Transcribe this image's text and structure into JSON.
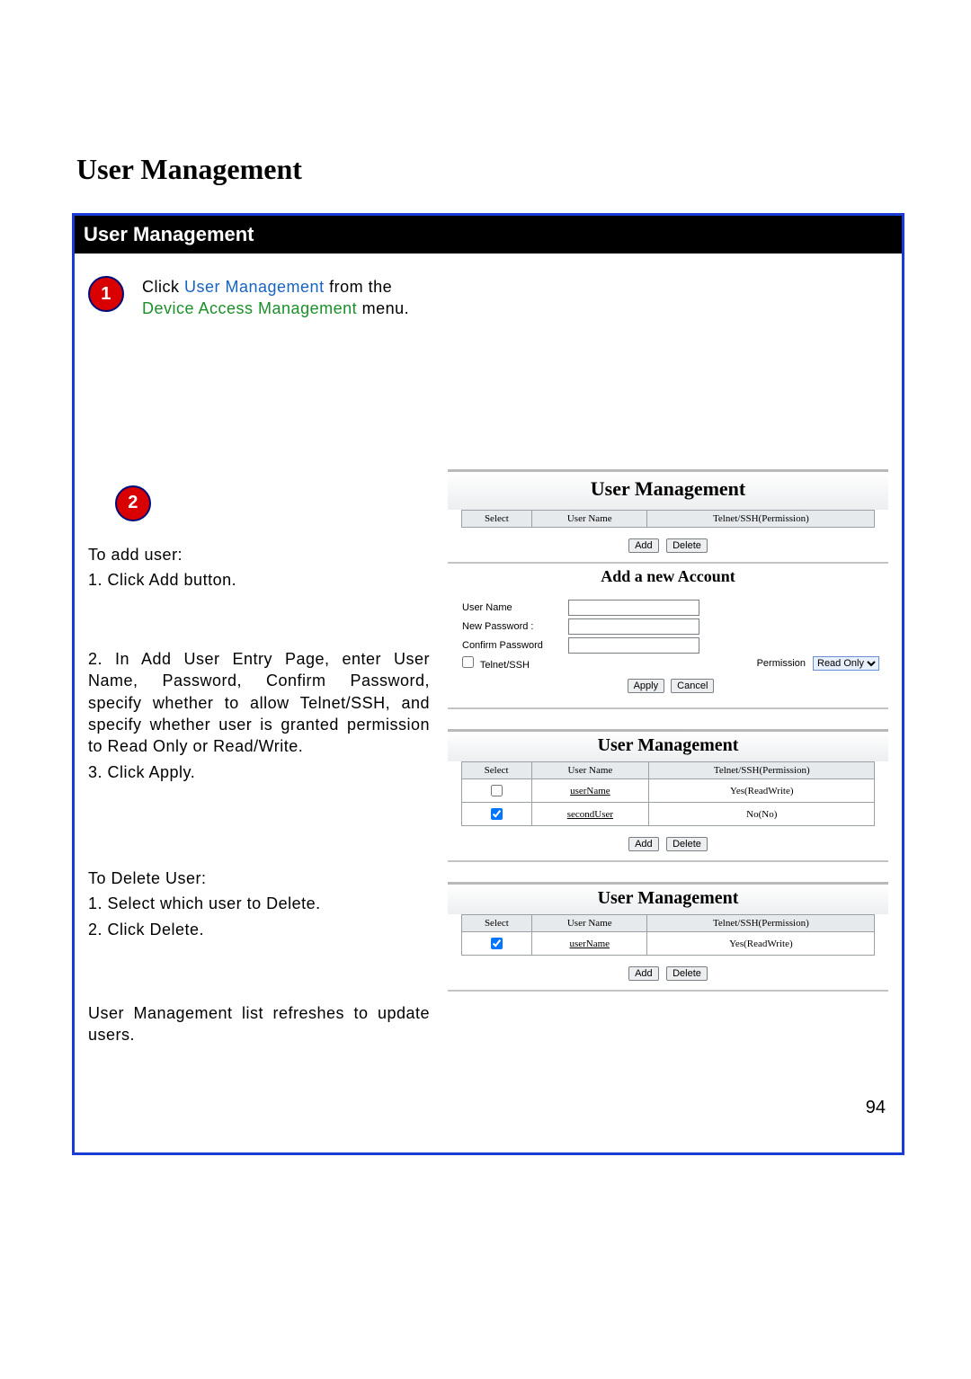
{
  "doc": {
    "title": "User Management",
    "page_number": "94"
  },
  "panel": {
    "header": "User Management"
  },
  "step1": {
    "badge": "1",
    "pre": "Click ",
    "link": "User Management",
    "mid": " from the ",
    "menu": "Device Access Management",
    "post": " menu."
  },
  "step2": {
    "badge": "2",
    "add_title": "To add user:",
    "add_1": "1. Click Add button.",
    "add_2": "2. In Add User Entry Page, enter User Name, Password, Confirm Password, specify whether to allow Telnet/SSH, and specify whether user is granted permission to Read Only or Read/Write.",
    "add_3": "3. Click Apply.",
    "del_title": "To Delete User:",
    "del_1": "1. Select which user to Delete.",
    "del_2": "2. Click Delete.",
    "refresh": "User Management list refreshes to update users."
  },
  "um_title": "User Management",
  "headers": {
    "select": "Select",
    "user": "User Name",
    "perm": "Telnet/SSH(Permission)"
  },
  "buttons": {
    "add": "Add",
    "delete": "Delete",
    "apply": "Apply",
    "cancel": "Cancel"
  },
  "add_account": {
    "title": "Add a new Account",
    "user_label": "User Name",
    "newpw_label": "New Password :",
    "confpw_label": "Confirm Password",
    "telnet_label": "Telnet/SSH",
    "perm_label": "Permission",
    "perm_value": "Read Only"
  },
  "table2": {
    "rows": [
      {
        "checked": false,
        "user": "userName",
        "perm": "Yes(ReadWrite)"
      },
      {
        "checked": true,
        "user": "secondUser",
        "perm": "No(No)"
      }
    ]
  },
  "table3": {
    "rows": [
      {
        "checked": true,
        "user": "userName",
        "perm": "Yes(ReadWrite)"
      }
    ]
  }
}
